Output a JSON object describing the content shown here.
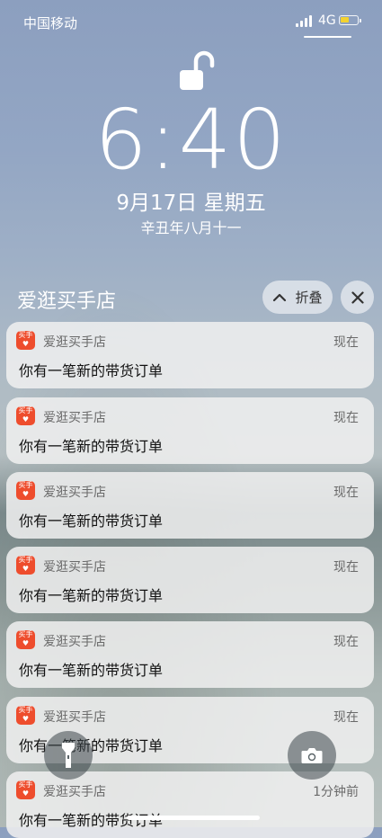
{
  "status_bar": {
    "carrier": "中国移动",
    "network": "4G",
    "battery_color": "#f3d22f"
  },
  "lock_screen": {
    "time": "6:40",
    "date": "9月17日 星期五",
    "lunar_date": "辛丑年八月十一"
  },
  "group": {
    "title": "爱逛买手店",
    "collapse_label": "折叠",
    "close_icon": "close-icon"
  },
  "notifications": [
    {
      "app_name": "爱逛买手店",
      "icon_label": "买手",
      "time": "现在",
      "body": "你有一笔新的带货订单"
    },
    {
      "app_name": "爱逛买手店",
      "icon_label": "买手",
      "time": "现在",
      "body": "你有一笔新的带货订单"
    },
    {
      "app_name": "爱逛买手店",
      "icon_label": "买手",
      "time": "现在",
      "body": "你有一笔新的带货订单"
    },
    {
      "app_name": "爱逛买手店",
      "icon_label": "买手",
      "time": "现在",
      "body": "你有一笔新的带货订单"
    },
    {
      "app_name": "爱逛买手店",
      "icon_label": "买手",
      "time": "现在",
      "body": "你有一笔新的带货订单"
    },
    {
      "app_name": "爱逛买手店",
      "icon_label": "买手",
      "time": "现在",
      "body": "你有一笔新的带货订单"
    },
    {
      "app_name": "爱逛买手店",
      "icon_label": "买手",
      "time": "1分钟前",
      "body": "你有一笔新的带货订单"
    }
  ],
  "app_icon_color": "#ee4d2d",
  "bottom": {
    "left_icon": "flashlight-icon",
    "right_icon": "camera-icon"
  }
}
